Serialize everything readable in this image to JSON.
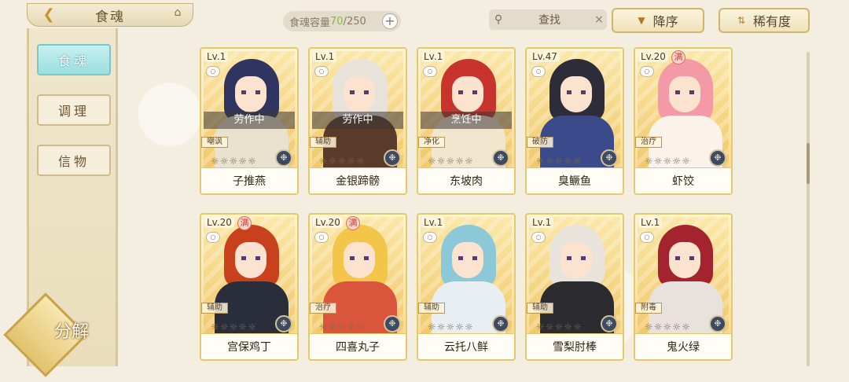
{
  "header": {
    "title": "食魂",
    "back_icon": "back-arrow-icon",
    "home_icon": "home-icon"
  },
  "capacity": {
    "label": "食魂容量",
    "current": "70",
    "separator": "/",
    "max": "250",
    "add_label": "+"
  },
  "search": {
    "label": "查找",
    "clear_label": "×"
  },
  "sort": {
    "order_label": "降序",
    "rarity_label": "稀有度"
  },
  "sidebar": {
    "items": [
      {
        "label": "食魂",
        "active": true
      },
      {
        "label": "调理",
        "active": false
      },
      {
        "label": "信物",
        "active": false
      }
    ],
    "decompose_label": "分解"
  },
  "cards": [
    {
      "level": "Lv.1",
      "max": "",
      "status": "劳作中",
      "role": "嘲讽",
      "stars": 0,
      "name": "子推燕",
      "hair": "#2f3560",
      "outfit": "#e9e2cf"
    },
    {
      "level": "Lv.1",
      "max": "",
      "status": "劳作中",
      "role": "辅助",
      "stars": 0,
      "name": "金银蹄髈",
      "hair": "#e7e3da",
      "outfit": "#5a3a28"
    },
    {
      "level": "Lv.1",
      "max": "",
      "status": "烹饪中",
      "role": "净化",
      "stars": 0,
      "name": "东坡肉",
      "hair": "#c8342c",
      "outfit": "#f2e6cf"
    },
    {
      "level": "Lv.47",
      "max": "",
      "status": "",
      "role": "破防",
      "stars": 0,
      "name": "臭鳜鱼",
      "hair": "#2d2d3a",
      "outfit": "#3a4a8a"
    },
    {
      "level": "Lv.20",
      "max": "满",
      "status": "",
      "role": "治疗",
      "stars": 0,
      "name": "虾饺",
      "hair": "#f49aa6",
      "outfit": "#fbf2ec"
    },
    {
      "level": "Lv.20",
      "max": "满",
      "status": "",
      "role": "辅助",
      "stars": 0,
      "name": "宫保鸡丁",
      "hair": "#c8401c",
      "outfit": "#2a2e3a"
    },
    {
      "level": "Lv.20",
      "max": "满",
      "status": "",
      "role": "治疗",
      "stars": 0,
      "name": "四喜丸子",
      "hair": "#f3c64a",
      "outfit": "#d9563c"
    },
    {
      "level": "Lv.1",
      "max": "",
      "status": "",
      "role": "辅助",
      "stars": 0,
      "name": "云托八鲜",
      "hair": "#8bc8d8",
      "outfit": "#e9eef2"
    },
    {
      "level": "Lv.1",
      "max": "",
      "status": "",
      "role": "辅助",
      "stars": 0,
      "name": "雪梨肘棒",
      "hair": "#e8e4dc",
      "outfit": "#2b2b30"
    },
    {
      "level": "Lv.1",
      "max": "",
      "status": "",
      "role": "附毒",
      "stars": 0,
      "name": "鬼火绿",
      "hair": "#a3242e",
      "outfit": "#e9e2dc"
    }
  ],
  "colors": {
    "active_tab": "#9adfe0",
    "card_border": "#e7c86a",
    "capacity_current": "#8ab94a"
  }
}
